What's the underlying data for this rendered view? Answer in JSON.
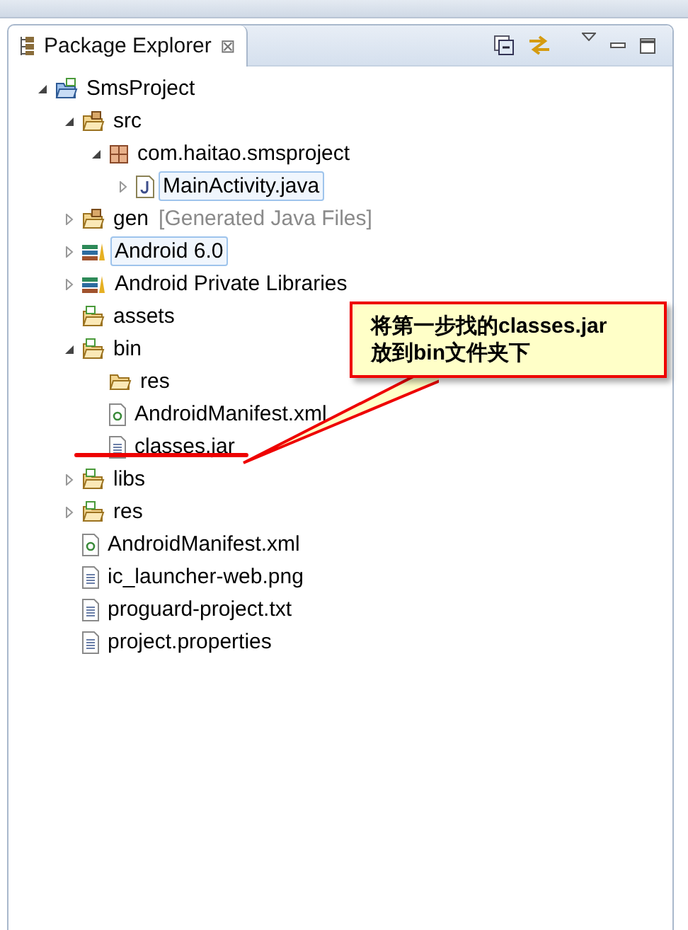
{
  "view": {
    "title": "Package Explorer",
    "close": "⊠"
  },
  "tree": [
    {
      "label": "SmsProject",
      "kind": "project",
      "expanded": true,
      "children": [
        {
          "label": "src",
          "kind": "source-folder",
          "expanded": true,
          "children": [
            {
              "label": "com.haitao.smsproject",
              "kind": "package",
              "expanded": true,
              "children": [
                {
                  "label": "MainActivity.java",
                  "kind": "java",
                  "expanded": false,
                  "selected": true
                }
              ]
            }
          ]
        },
        {
          "label": "gen",
          "decoration": "[Generated Java Files]",
          "kind": "source-folder",
          "expanded": false
        },
        {
          "label": "Android 6.0",
          "kind": "library",
          "expanded": false,
          "selected": true
        },
        {
          "label": "Android Private Libraries",
          "kind": "library",
          "expanded": false
        },
        {
          "label": "assets",
          "kind": "android-folder"
        },
        {
          "label": "bin",
          "kind": "android-folder",
          "expanded": true,
          "children": [
            {
              "label": "res",
              "kind": "folder"
            },
            {
              "label": "AndroidManifest.xml",
              "kind": "xml"
            },
            {
              "label": "classes.jar",
              "kind": "file"
            }
          ]
        },
        {
          "label": "libs",
          "kind": "android-folder",
          "expanded": false
        },
        {
          "label": "res",
          "kind": "android-folder",
          "expanded": false
        },
        {
          "label": "AndroidManifest.xml",
          "kind": "xml"
        },
        {
          "label": "ic_launcher-web.png",
          "kind": "file"
        },
        {
          "label": "proguard-project.txt",
          "kind": "file"
        },
        {
          "label": "project.properties",
          "kind": "file"
        }
      ]
    }
  ],
  "callout": {
    "lines": [
      "将第一步找的classes.jar",
      "放到bin文件夹下"
    ]
  }
}
